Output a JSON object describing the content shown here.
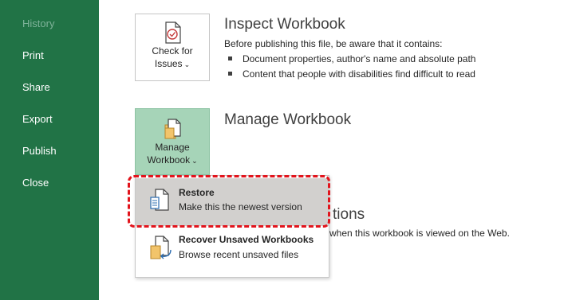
{
  "sidebar": {
    "items": [
      {
        "label": "History",
        "state": "disabled"
      },
      {
        "label": "Print"
      },
      {
        "label": "Share"
      },
      {
        "label": "Export"
      },
      {
        "label": "Publish"
      },
      {
        "label": "Close"
      }
    ]
  },
  "inspect": {
    "button_line1": "Check for",
    "button_line2": "Issues",
    "title": "Inspect Workbook",
    "description": "Before publishing this file, be aware that it contains:",
    "bullets": [
      "Document properties, author's name and absolute path",
      "Content that people with disabilities find difficult to read"
    ]
  },
  "manage": {
    "button_line1": "Manage",
    "button_line2": "Workbook",
    "title": "Manage Workbook"
  },
  "browser_view": {
    "title_fragment": "tions",
    "description_fragment": "when this workbook is viewed on the Web."
  },
  "menu": {
    "items": [
      {
        "title": "Restore",
        "subtitle": "Make this the newest version",
        "icon": "restore-document-icon",
        "hovered": true
      },
      {
        "title": "Recover Unsaved Workbooks",
        "subtitle": "Browse recent unsaved files",
        "icon": "recover-folder-icon"
      }
    ]
  },
  "colors": {
    "sidebar": "#217346",
    "active_button": "#a6d4b8",
    "menu_hover": "#d2d0ce",
    "highlight_outline": "#e2141c"
  }
}
